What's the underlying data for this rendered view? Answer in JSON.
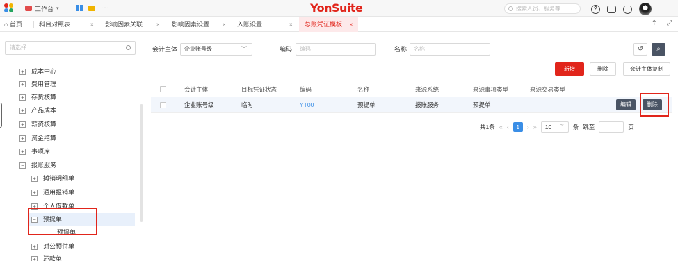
{
  "topbar": {
    "workspace_label": "工作台",
    "more_label": "···",
    "brand": "YonSuite",
    "search_placeholder": "搜索人员、服务等",
    "help_label": "?"
  },
  "tabs": [
    {
      "label": "首页",
      "closable": false,
      "active": false
    },
    {
      "label": "科目对照表",
      "closable": true,
      "active": false
    },
    {
      "label": "影响因素关联",
      "closable": true,
      "active": false
    },
    {
      "label": "影响因素设置",
      "closable": true,
      "active": false
    },
    {
      "label": "入账设置",
      "closable": true,
      "active": false
    },
    {
      "label": "总账凭证模板",
      "closable": true,
      "active": true
    }
  ],
  "tab_close_glyph": "×",
  "sidebar": {
    "search_placeholder": "请选择",
    "items": [
      {
        "label": "成本中心",
        "toggle": "+"
      },
      {
        "label": "费用管理",
        "toggle": "+"
      },
      {
        "label": "存货核算",
        "toggle": "+"
      },
      {
        "label": "产品成本",
        "toggle": "+"
      },
      {
        "label": "薪资核算",
        "toggle": "+"
      },
      {
        "label": "资金结算",
        "toggle": "+"
      },
      {
        "label": "事项库",
        "toggle": "+"
      },
      {
        "label": "报账服务",
        "toggle": "−"
      },
      {
        "label": "摊销明细单",
        "toggle": "+"
      },
      {
        "label": "通用报销单",
        "toggle": "+"
      },
      {
        "label": "个人借款单",
        "toggle": "+"
      },
      {
        "label": "预提单",
        "toggle": "−"
      },
      {
        "label": "预提单",
        "toggle": ""
      },
      {
        "label": "对公预付单",
        "toggle": "+"
      },
      {
        "label": "还款单",
        "toggle": "+"
      }
    ]
  },
  "filters": {
    "entity_label": "会计主体",
    "entity_value": "企业账号级",
    "code_label": "编码",
    "code_placeholder": "编码",
    "name_label": "名称",
    "name_placeholder": "名称"
  },
  "toolbar": {
    "new_label": "新增",
    "delete_label": "删除",
    "copy_label": "会计主体复制"
  },
  "table": {
    "headers": [
      "会计主体",
      "目标凭证状态",
      "编码",
      "名称",
      "来源系统",
      "来源事项类型",
      "来源交易类型"
    ],
    "rows": [
      {
        "cells": [
          "企业账号级",
          "临时",
          "YT00",
          "预提单",
          "报账服务",
          "预提单",
          ""
        ],
        "edit_label": "编辑",
        "delete_label": "删除"
      }
    ]
  },
  "pager": {
    "total": "共1条",
    "first": "«",
    "prev": "‹",
    "current": "1",
    "next": "›",
    "last": "»",
    "page_size": "10",
    "per_page_label": "条",
    "jump_label": "跳至",
    "page_suffix": "页"
  },
  "colors": {
    "brand_red": "#e1251b",
    "link_blue": "#3a8ee6",
    "dark_button": "#4a5464",
    "row_highlight": "#f2f6fc"
  }
}
